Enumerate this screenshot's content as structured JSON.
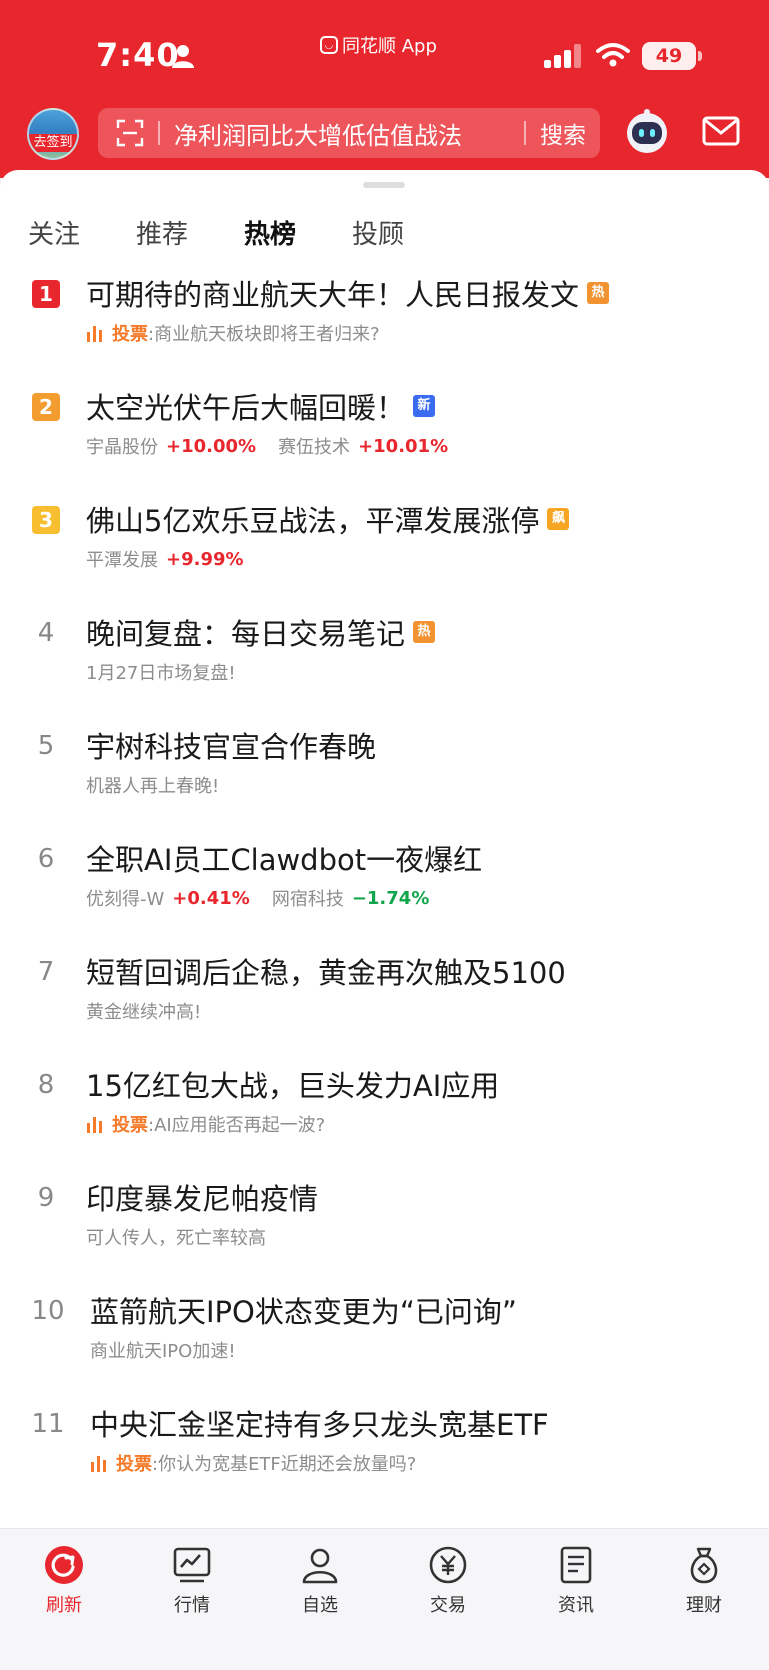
{
  "status_bar": {
    "time": "7:40",
    "app_name": "同花顺 App",
    "battery": "49"
  },
  "header": {
    "checkin_label": "去签到",
    "search_placeholder": "净利润同比大增低估值战法",
    "search_button": "搜索"
  },
  "tabs": [
    {
      "label": "关注",
      "active": false
    },
    {
      "label": "推荐",
      "active": false
    },
    {
      "label": "热榜",
      "active": true
    },
    {
      "label": "投顾",
      "active": false
    }
  ],
  "hot_list": [
    {
      "rank": "1",
      "title": "可期待的商业航天大年！人民日报发文",
      "tag": "热",
      "vote_label": "投票",
      "vote_text": ":商业航天板块即将王者归来?"
    },
    {
      "rank": "2",
      "title": "太空光伏午后大幅回暖！",
      "tag": "新",
      "stocks": [
        {
          "name": "宇晶股份",
          "change": "+10.00%"
        },
        {
          "name": "赛伍技术",
          "change": "+10.01%"
        }
      ]
    },
    {
      "rank": "3",
      "title": "佛山5亿欢乐豆战法，平潭发展涨停",
      "tag": "飙",
      "stocks": [
        {
          "name": "平潭发展",
          "change": "+9.99%"
        }
      ]
    },
    {
      "rank": "4",
      "title": "晚间复盘：每日交易笔记",
      "tag": "热",
      "subtitle": "1月27日市场复盘!"
    },
    {
      "rank": "5",
      "title": "宇树科技官宣合作春晚",
      "subtitle": "机器人再上春晚!"
    },
    {
      "rank": "6",
      "title": "全职AI员工Clawdbot一夜爆红",
      "stocks": [
        {
          "name": "优刻得-W",
          "change": "+0.41%"
        },
        {
          "name": "网宿科技",
          "change": "−1.74%"
        }
      ]
    },
    {
      "rank": "7",
      "title": "短暂回调后企稳，黄金再次触及5100",
      "subtitle": "黄金继续冲高!"
    },
    {
      "rank": "8",
      "title": "15亿红包大战，巨头发力AI应用",
      "vote_label": "投票",
      "vote_text": ":AI应用能否再起一波?"
    },
    {
      "rank": "9",
      "title": "印度暴发尼帕疫情",
      "subtitle": "可人传人，死亡率较高"
    },
    {
      "rank": "10",
      "title": "蓝箭航天IPO状态变更为“已问询”",
      "subtitle": "商业航天IPO加速!"
    },
    {
      "rank": "11",
      "title": "中央汇金坚定持有多只龙头宽基ETF",
      "vote_label": "投票",
      "vote_text": ":你认为宽基ETF近期还会放量吗?"
    }
  ],
  "bottom_nav": [
    {
      "label": "刷新",
      "icon": "refresh-icon",
      "active": true
    },
    {
      "label": "行情",
      "icon": "market-chart-icon",
      "active": false
    },
    {
      "label": "自选",
      "icon": "watchlist-person-icon",
      "active": false
    },
    {
      "label": "交易",
      "icon": "yuan-trade-icon",
      "active": false
    },
    {
      "label": "资讯",
      "icon": "news-doc-icon",
      "active": false
    },
    {
      "label": "理财",
      "icon": "money-bag-icon",
      "active": false
    }
  ],
  "colors": {
    "brand_red": "#e8262d",
    "rise": "#e8262d",
    "fall": "#12a64c",
    "vote_orange": "#f57a2a"
  }
}
